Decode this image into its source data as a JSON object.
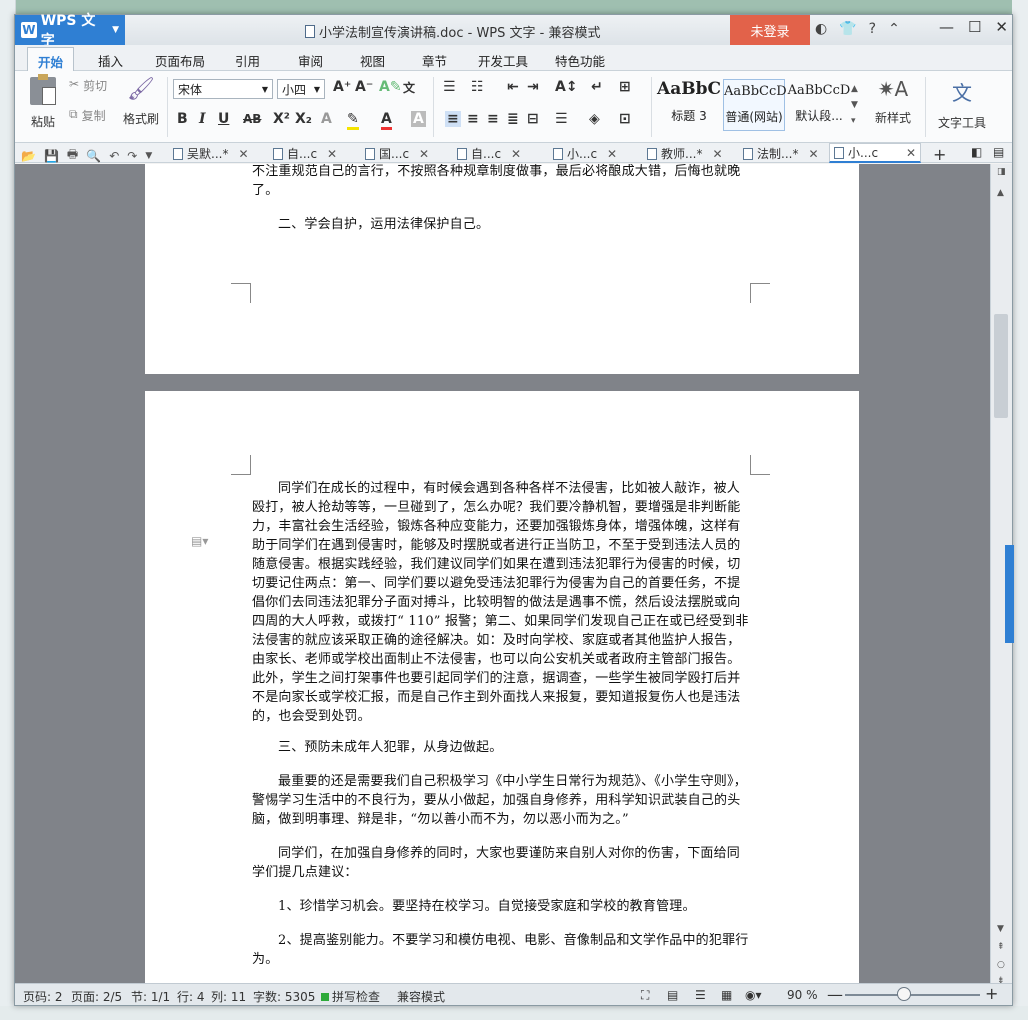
{
  "app": {
    "name": "WPS 文字",
    "logo": "W"
  },
  "window": {
    "title": "小学法制宣传演讲稿.doc - WPS 文字 - 兼容模式",
    "login": "未登录"
  },
  "ribbon_tabs": [
    "开始",
    "插入",
    "页面布局",
    "引用",
    "审阅",
    "视图",
    "章节",
    "开发工具",
    "特色功能"
  ],
  "clipboard": {
    "paste": "粘贴",
    "cut": "剪切",
    "copy": "复制",
    "format_painter": "格式刷"
  },
  "font": {
    "name": "宋体",
    "size": "小四"
  },
  "styles": [
    {
      "sample": "AaBbC",
      "label": "标题 3"
    },
    {
      "sample": "AaBbCcD",
      "label": "普通(网站)"
    },
    {
      "sample": "AaBbCcD",
      "label": "默认段..."
    }
  ],
  "new_style": "新样式",
  "text_tools": "文字工具",
  "doc_tabs": [
    "吴默...*",
    "自...c",
    "国...c",
    "自...c",
    "小...c",
    "教师...*",
    "法制...*",
    "小...c"
  ],
  "document": {
    "p0": "不注重规范自己的言行，不按照各种规章制度做事，最后必将酿成大错，后悔也就晚了。",
    "p1": "二、学会自护，运用法律保护自己。",
    "p2": "同学们在成长的过程中，有时候会遇到各种各样不法侵害，比如被人敲诈，被人殴打，被人抢劫等等，一旦碰到了，怎么办呢？我们要冷静机智，要增强是非判断能力，丰富社会生活经验，锻炼各种应变能力，还要加强锻炼身体，增强体魄，这样有助于同学们在遇到侵害时，能够及时摆脱或者进行正当防卫，不至于受到违法人员的随意侵害。根据实践经验，我们建议同学们如果在遭到违法犯罪行为侵害的时候，切切要记住两点：第一、同学们要以避免受违法犯罪行为侵害为自己的首要任务，不提倡你们去同违法犯罪分子面对搏斗，比较明智的做法是遇事不慌，然后设法摆脱或向四周的大人呼救，或拨打“ 110” 报警；第二、如果同学们发现自己正在或已经受到非法侵害的就应该采取正确的途径解决。如：及时向学校、家庭或者其他监护人报告，由家长、老师或学校出面制止不法侵害，也可以向公安机关或者政府主管部门报告。此外，学生之间打架事件也要引起同学们的注意，据调查，一些学生被同学殴打后并不是向家长或学校汇报，而是自己作主到外面找人来报复，要知道报复伤人也是违法的，也会受到处罚。",
    "p3": "三、预防未成年人犯罪，从身边做起。",
    "p4": "最重要的还是需要我们自己积极学习《中小学生日常行为规范》、《小学生守则》，警惕学习生活中的不良行为，要从小做起，加强自身修养，用科学知识武装自己的头脑，做到明事理、辩是非，“勿以善小而不为，勿以恶小而为之。”",
    "p5": "同学们，在加强自身修养的同时，大家也要谨防来自别人对你的伤害，下面给同学们提几点建议：",
    "p6": "1、珍惜学习机会。要坚持在校学习。自觉接受家庭和学校的教育管理。",
    "p7": "2、提高鉴别能力。不要学习和模仿电视、电影、音像制品和文学作品中的犯罪行为。"
  },
  "status": {
    "page_code": "页码: 2",
    "pages": "页面: 2/5",
    "section": "节: 1/1",
    "row": "行: 4",
    "col": "列: 11",
    "words": "字数: 5305",
    "spell": "拼写检查",
    "mode": "兼容模式",
    "zoom": "90 %"
  }
}
